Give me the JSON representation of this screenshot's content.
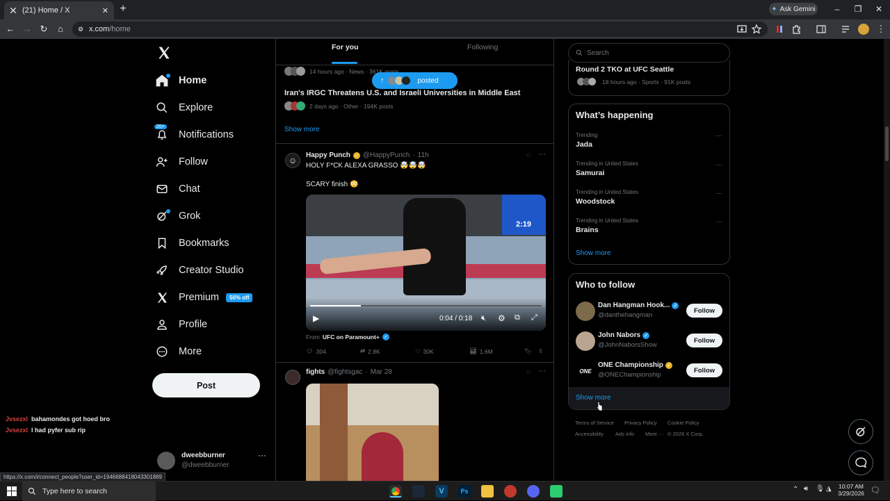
{
  "browser": {
    "tab_title": "(21) Home / X",
    "new_tab": "+",
    "ask_gemini": "Ask Gemini",
    "url_host": "x.com",
    "url_path": "/home",
    "status_url": "https://x.com/i/connect_people?user_id=1946688418043301889"
  },
  "sidebar": {
    "items": [
      {
        "label": "Home",
        "icon": "home-icon"
      },
      {
        "label": "Explore",
        "icon": "search-icon"
      },
      {
        "label": "Notifications",
        "icon": "bell-icon",
        "badge": "20+"
      },
      {
        "label": "Follow",
        "icon": "add-person-icon"
      },
      {
        "label": "Chat",
        "icon": "mail-icon"
      },
      {
        "label": "Grok",
        "icon": "grok-icon"
      },
      {
        "label": "Bookmarks",
        "icon": "bookmark-icon"
      },
      {
        "label": "Creator Studio",
        "icon": "rocket-icon"
      },
      {
        "label": "Premium",
        "icon": "x-logo-icon",
        "badge": "50% off"
      },
      {
        "label": "Profile",
        "icon": "person-icon"
      },
      {
        "label": "More",
        "icon": "more-circle-icon"
      }
    ],
    "post_label": "Post",
    "account": {
      "name": "dweebburner",
      "handle": "@dweebburner"
    }
  },
  "stream_chat": [
    {
      "user": "Jvsezxl",
      "message": "bahamondes got hoed bro"
    },
    {
      "user": "Jvsezxl",
      "message": "I had pyfer sub rip"
    }
  ],
  "feed": {
    "tabs": [
      "For you",
      "Following"
    ],
    "posted_pill": "posted",
    "news": [
      {
        "meta": "14 hours ago · News · 361K posts"
      },
      {
        "headline": "Iran's IRGC Threatens U.S. and Israeli Universities in Middle East",
        "meta": "2 days ago · Other · 194K posts"
      }
    ],
    "show_more": "Show more",
    "post1": {
      "name": "Happy Punch",
      "handle": "@HappyPunch",
      "time": "11h",
      "text1": "HOLY F*CK ALEXA GRASSO 🤯🤯🤯",
      "text2": "SCARY finish 😳",
      "video_time": "0:04 / 0:18",
      "video_overlay_clock": "2:19",
      "from_label": "From",
      "from_source": "UFC on Paramount+",
      "replies": "304",
      "reposts": "2.8K",
      "likes": "30K",
      "views": "1.6M"
    },
    "post2": {
      "name": "fights",
      "handle": "@fightsgac",
      "time": "Mar 28"
    }
  },
  "right": {
    "search_placeholder": "Search",
    "top_card": {
      "title": "Round 2 TKO at UFC Seattle",
      "meta": "18 hours ago · Sports · 91K posts"
    },
    "whats_happening": {
      "title": "What’s happening",
      "trends": [
        {
          "context": "Trending",
          "name": "Jada"
        },
        {
          "context": "Trending in United States",
          "name": "Samurai"
        },
        {
          "context": "Trending in United States",
          "name": "Woodstock"
        },
        {
          "context": "Trending in United States",
          "name": "Brains"
        }
      ],
      "show_more": "Show more"
    },
    "who_to_follow": {
      "title": "Who to follow",
      "accounts": [
        {
          "name": "Dan Hangman Hook...",
          "handle": "@danthehangman",
          "verified": "blue"
        },
        {
          "name": "John Nabors",
          "handle": "@JohnNaborsShow",
          "verified": "blue"
        },
        {
          "name": "ONE Championship",
          "handle": "@ONEChampionship",
          "verified": "gold"
        }
      ],
      "follow_label": "Follow",
      "show_more": "Show more"
    },
    "footer": [
      "Terms of Service",
      "Privacy Policy",
      "Cookie Policy",
      "Accessibility",
      "Ads info",
      "More ···",
      "© 2026 X Corp."
    ]
  },
  "taskbar": {
    "search_placeholder": "Type here to search",
    "time": "10:07 AM",
    "date": "3/29/2026"
  },
  "colors": {
    "accent": "#1d9bf0",
    "background": "#000000",
    "border": "#2f3336",
    "muted": "#71767b"
  }
}
